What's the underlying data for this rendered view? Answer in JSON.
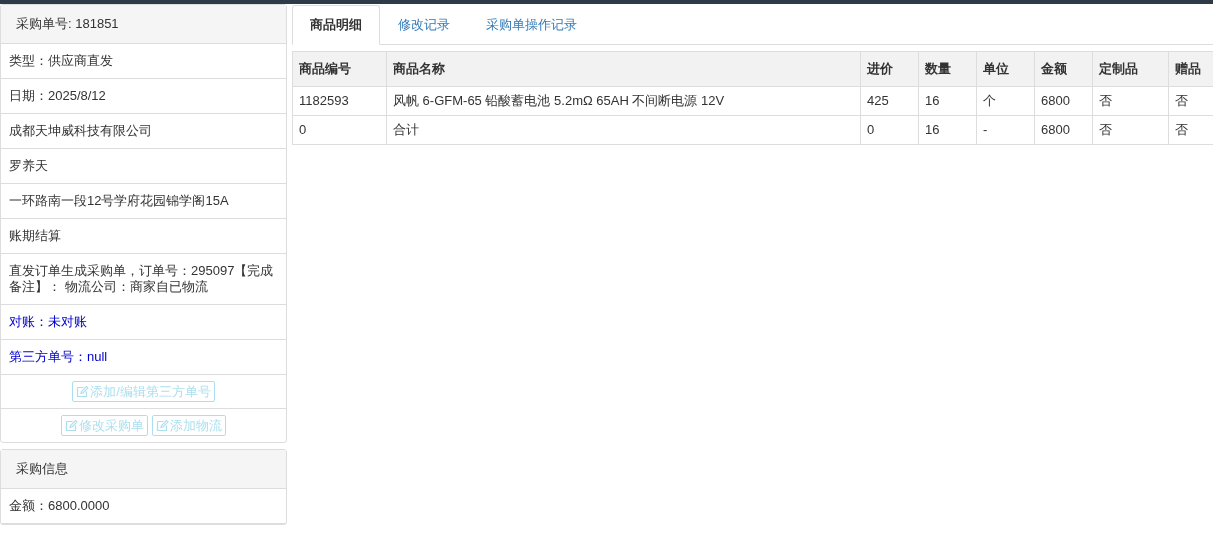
{
  "order_panel": {
    "title": "采购单号: 181851",
    "items": [
      {
        "text": "类型：供应商直发",
        "kind": "plain"
      },
      {
        "text": "日期：2025/8/12",
        "kind": "plain"
      },
      {
        "text": "成都天坤威科技有限公司",
        "kind": "plain"
      },
      {
        "text": "罗养天",
        "kind": "plain"
      },
      {
        "text": "一环路南一段12号学府花园锦学阁15A",
        "kind": "plain"
      },
      {
        "text": "账期结算",
        "kind": "plain"
      },
      {
        "text": "直发订单生成采购单，订单号：295097【完成备注】： 物流公司：商家自已物流",
        "kind": "plain"
      },
      {
        "text": "对账：未对账",
        "kind": "highlight"
      },
      {
        "text": "第三方单号：null",
        "kind": "highlight"
      }
    ],
    "button_rows": [
      [
        {
          "label": "添加/编辑第三方单号",
          "disabled": true
        }
      ],
      [
        {
          "label": "修改采购单",
          "disabled": true
        },
        {
          "label": "添加物流",
          "disabled": true
        }
      ]
    ]
  },
  "purchase_panel": {
    "title": "采购信息",
    "items": [
      {
        "text": "金额：6800.0000"
      }
    ]
  },
  "tabs": [
    {
      "label": "商品明细",
      "selected": true
    },
    {
      "label": "修改记录",
      "selected": false
    },
    {
      "label": "采购单操作记录",
      "selected": false
    }
  ],
  "table": {
    "columns": [
      "商品编号",
      "商品名称",
      "进价",
      "数量",
      "单位",
      "金额",
      "定制品",
      "赠品"
    ],
    "rows": [
      [
        "1182593",
        "风帆 6-GFM-65 铅酸蓄电池 5.2mΩ 65AH 不间断电源 12V",
        "425",
        "16",
        "个",
        "6800",
        "否",
        "否"
      ],
      [
        "0",
        "合计",
        "0",
        "16",
        "-",
        "6800",
        "否",
        "否"
      ]
    ]
  }
}
